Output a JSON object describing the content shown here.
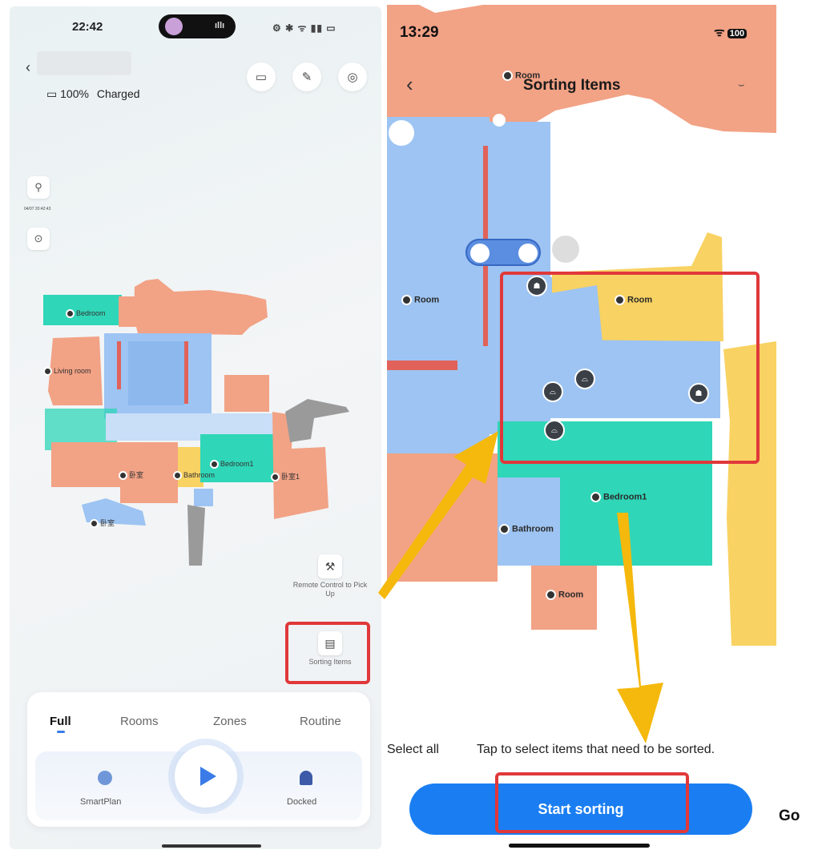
{
  "left_screen": {
    "status_time": "22:42",
    "battery_percent": "100%",
    "battery_status": "Charged",
    "timestamp_small": "04/07 20:42:43",
    "map_rooms": [
      "Bedroom",
      "Living room",
      "卧室",
      "Bathroom",
      "Bedroom1",
      "卧室1",
      "卧室"
    ],
    "tools": {
      "remote_control": "Remote Control to Pick Up",
      "sorting_items": "Sorting Items"
    },
    "tabs": [
      {
        "label": "Full",
        "active": true
      },
      {
        "label": "Rooms",
        "active": false
      },
      {
        "label": "Zones",
        "active": false
      },
      {
        "label": "Routine",
        "active": false
      }
    ],
    "controls": {
      "smartplan": "SmartPlan",
      "docked": "Docked"
    }
  },
  "right_screen": {
    "status_time": "13:29",
    "battery": "100",
    "title": "Sorting Items",
    "map_rooms": [
      "Room",
      "Room",
      "Room",
      "Bedroom1",
      "Bathroom",
      "Room"
    ],
    "select_all": "Select all",
    "hint": "Tap to select items that need to be sorted.",
    "start_button": "Start sorting"
  },
  "side_text": "Go",
  "colors": {
    "accent_blue": "#1a7ef2",
    "highlight_red": "#e0383a",
    "arrow_yellow": "#f5b80c",
    "room_salmon": "#f2a285",
    "room_blue": "#9dc4f2",
    "room_teal": "#2fd6b8",
    "room_yellow": "#f8d262"
  }
}
